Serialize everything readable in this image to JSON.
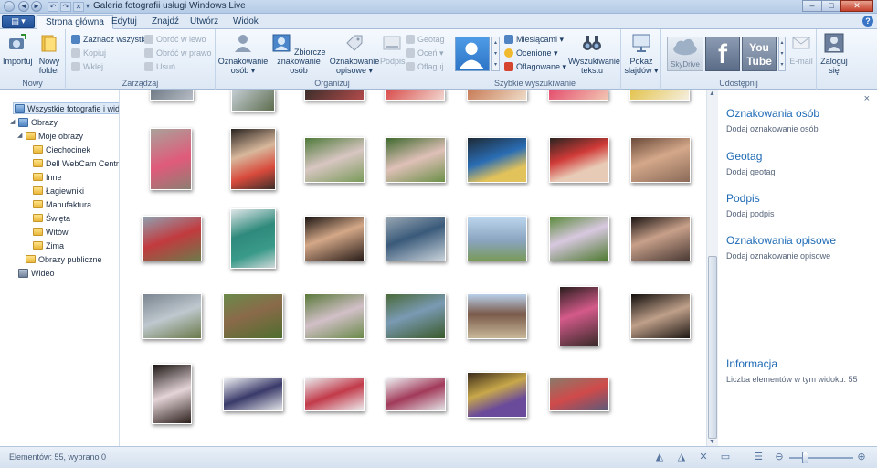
{
  "window": {
    "title": "Galeria fotografii usługi Windows Live",
    "minimize": "–",
    "maximize": "□",
    "close": "✕"
  },
  "qat": {
    "back": "◄",
    "forward": "►",
    "rotate_left": "↶",
    "rotate_right": "↷",
    "delete": "✕",
    "options": "▾"
  },
  "app_menu_label": "▤ ▾",
  "tabs": [
    "Strona główna",
    "Edytuj",
    "Znajdź",
    "Utwórz",
    "Widok"
  ],
  "help": "?",
  "ribbon": {
    "groups": {
      "nowy": "Nowy",
      "zarzadzaj": "Zarządzaj",
      "organizuj": "Organizuj",
      "szybkie": "Szybkie wyszukiwanie",
      "udostepnij": "Udostępnij"
    },
    "importuj": "Importuj",
    "nowy_folder": "Nowy folder",
    "zaznacz": "Zaznacz wszystko",
    "kopiuj": "Kopiuj",
    "wklej": "Wklej",
    "obroc_lewo": "Obróć w lewo",
    "obroc_prawo": "Obróć w prawo",
    "usun": "Usuń",
    "oznakowanie_osob": "Oznakowanie osób ▾",
    "zbiorcze": "Zbiorcze znakowanie osób",
    "oznakowanie_opisowe": "Oznakowanie opisowe ▾",
    "podpis": "Podpis",
    "geotag": "Geotag",
    "ocen": "Oceń ▾",
    "oflaguj": "Oflaguj",
    "miesiacami": "Miesiącami ▾",
    "ocenione": "Ocenione ▾",
    "oflagowane": "Oflagowane ▾",
    "wyszukiwanie": "Wyszukiwanie tekstu",
    "pokaz": "Pokaz slajdów ▾",
    "skydrive": "SkyDrive",
    "facebook": "f",
    "youtube": "You Tube",
    "email": "E-mail",
    "zaloguj": "Zaloguj się"
  },
  "nav": {
    "root": "Wszystkie fotografie i wideo",
    "obrazy": "Obrazy",
    "moje_obrazy": "Moje obrazy",
    "folders": [
      "Ciechocinek",
      "Dell WebCam Central",
      "Inne",
      "Łagiewniki",
      "Manufaktura",
      "Święta",
      "Witów",
      "Zima"
    ],
    "obrazy_publiczne": "Obrazy publiczne",
    "wideo": "Wideo"
  },
  "pane": {
    "items": [
      {
        "title": "Oznakowania osób",
        "sub": "Dodaj oznakowanie osób"
      },
      {
        "title": "Geotag",
        "sub": "Dodaj geotag"
      },
      {
        "title": "Podpis",
        "sub": "Dodaj podpis"
      },
      {
        "title": "Oznakowania opisowe",
        "sub": "Dodaj oznakowanie opisowe"
      }
    ],
    "info_title": "Informacja",
    "info_text": "Liczba elementów w tym widoku: 55",
    "close": "×"
  },
  "status": {
    "text": "Elementów: 55, wybrano 0"
  },
  "colors": {
    "accent": "#1e6ab5",
    "selection": "#dde9f7"
  }
}
